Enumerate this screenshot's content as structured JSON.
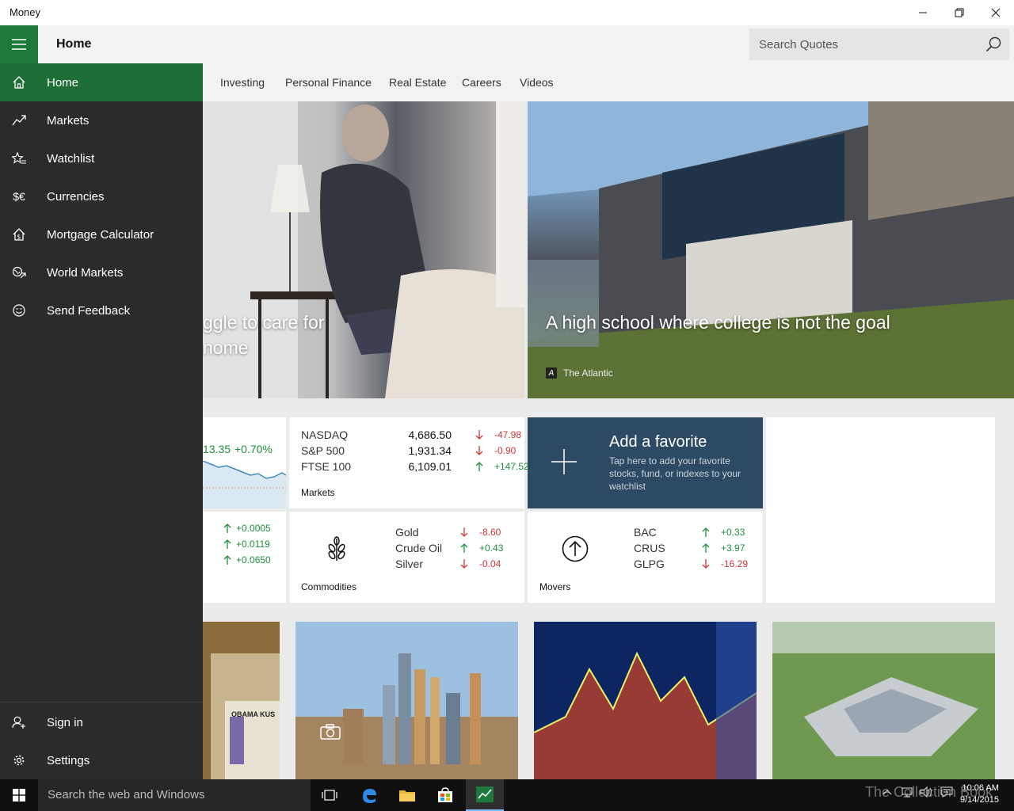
{
  "window": {
    "title": "Money"
  },
  "header": {
    "page_title": "Home",
    "search_placeholder": "Search Quotes"
  },
  "tabs": [
    "Investing",
    "Personal Finance",
    "Real Estate",
    "Careers",
    "Videos"
  ],
  "hero": {
    "left_headline_line1": "ggle to care for",
    "left_headline_line2": "nome",
    "right_headline": "A high school where college is not the goal",
    "right_source": "The Atlantic",
    "right_source_logo": "A"
  },
  "index_tile": {
    "value": "13.35",
    "change": "+0.70%"
  },
  "markets": {
    "label": "Markets",
    "rows": [
      {
        "name": "NASDAQ",
        "value": "4,686.50",
        "change": "-47.98",
        "dir": "down"
      },
      {
        "name": "S&P 500",
        "value": "1,931.34",
        "change": "-0.90",
        "dir": "down"
      },
      {
        "name": "FTSE 100",
        "value": "6,109.01",
        "change": "+147.52",
        "dir": "up"
      }
    ]
  },
  "add_favorite": {
    "title": "Add a favorite",
    "description": "Tap here to add your favorite stocks, fund, or indexes to your watchlist"
  },
  "currencies_tile": {
    "changes": [
      "+0.0005",
      "+0.0119",
      "+0.0650"
    ]
  },
  "commodities": {
    "label": "Commodities",
    "rows": [
      {
        "name": "Gold",
        "change": "-8.60",
        "dir": "down"
      },
      {
        "name": "Crude Oil",
        "change": "+0.43",
        "dir": "up"
      },
      {
        "name": "Silver",
        "change": "-0.04",
        "dir": "down"
      }
    ]
  },
  "movers": {
    "label": "Movers",
    "rows": [
      {
        "name": "BAC",
        "change": "+0.33",
        "dir": "up"
      },
      {
        "name": "CRUS",
        "change": "+3.97",
        "dir": "up"
      },
      {
        "name": "GLPG",
        "change": "-16.29",
        "dir": "down"
      }
    ]
  },
  "news_jar_text": "OBAMA KUS",
  "sidebar": {
    "items": [
      {
        "label": "Home",
        "icon": "home-icon"
      },
      {
        "label": "Markets",
        "icon": "chart-icon"
      },
      {
        "label": "Watchlist",
        "icon": "star-list-icon"
      },
      {
        "label": "Currencies",
        "icon": "currency-icon",
        "glyph": "$€"
      },
      {
        "label": "Mortgage Calculator",
        "icon": "house-dollar-icon"
      },
      {
        "label": "World Markets",
        "icon": "globe-icon"
      },
      {
        "label": "Send Feedback",
        "icon": "smiley-icon"
      }
    ],
    "bottom": [
      {
        "label": "Sign in",
        "icon": "person-add-icon"
      },
      {
        "label": "Settings",
        "icon": "gear-icon"
      }
    ]
  },
  "taskbar": {
    "search_text": "Search the web and Windows",
    "watermark": "The Collection Book",
    "time": "10:06 AM",
    "date": "9/14/2015"
  },
  "colors": {
    "accent": "#1e7a3c",
    "up": "#1e8f3c",
    "down": "#d0343a",
    "tile_dark": "#2d4a64"
  }
}
